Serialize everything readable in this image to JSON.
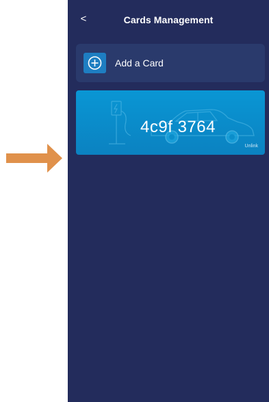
{
  "header": {
    "back_icon": "<",
    "title": "Cards Management"
  },
  "add_card": {
    "icon": "plus-circle-icon",
    "label": "Add a Card"
  },
  "card": {
    "number": "4c9f 3764",
    "unlink_label": "Unlink",
    "illustration": "charging-station-and-car"
  },
  "pointer": {
    "icon": "arrow-right-icon",
    "color": "#e0914b"
  },
  "colors": {
    "background": "#232c5c",
    "add_card_bg": "#2a3a6c",
    "accent": "#1e7ec2",
    "card": "#0a96d4"
  }
}
